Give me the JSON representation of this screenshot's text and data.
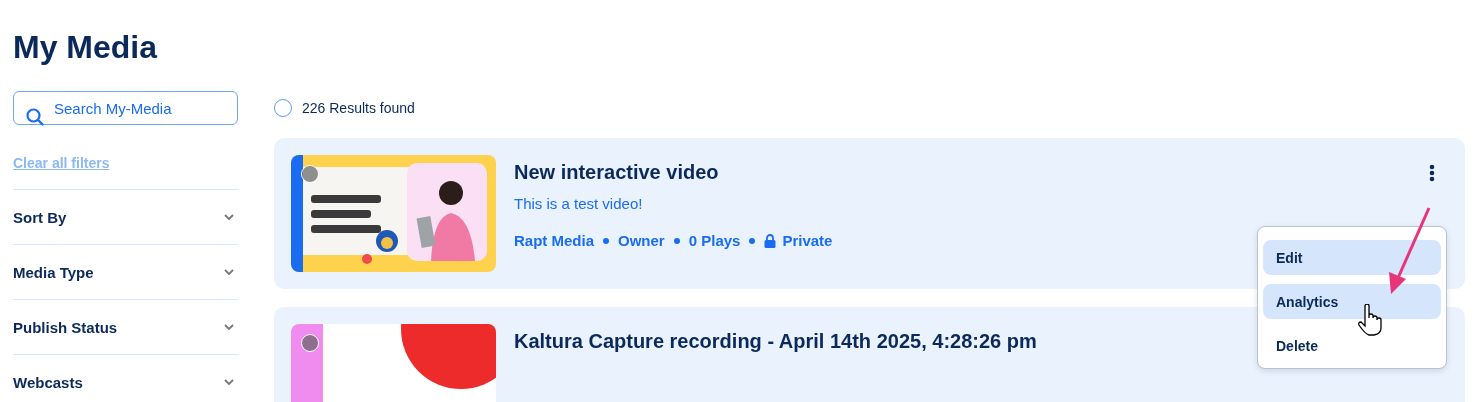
{
  "page": {
    "title": "My Media"
  },
  "sidebar": {
    "search": {
      "placeholder": "Search My-Media"
    },
    "clear_link": "Clear all filters",
    "filters": [
      {
        "label": "Sort By",
        "expanded": false
      },
      {
        "label": "Media Type",
        "expanded": false
      },
      {
        "label": "Publish Status",
        "expanded": false
      },
      {
        "label": "Webcasts",
        "expanded": false
      }
    ]
  },
  "results": {
    "select_all": {
      "checked": false
    },
    "count": "226 Results found"
  },
  "media": [
    {
      "title": "New interactive video",
      "description": "This is a test video!",
      "meta": [
        "Rapt Media",
        "Owner",
        "0 Plays"
      ],
      "privacy": "Private",
      "checked": false,
      "thumb": {
        "kind": "picture"
      }
    },
    {
      "title": "Kaltura Capture recording - April 14th 2025, 4:28:26 pm",
      "checked": false,
      "thumb": {
        "kind": "picture"
      }
    }
  ],
  "menu": {
    "items": [
      {
        "label": "Edit",
        "highlighted": true
      },
      {
        "label": "Analytics",
        "highlighted": true
      },
      {
        "label": "Delete",
        "highlighted": false
      }
    ]
  }
}
